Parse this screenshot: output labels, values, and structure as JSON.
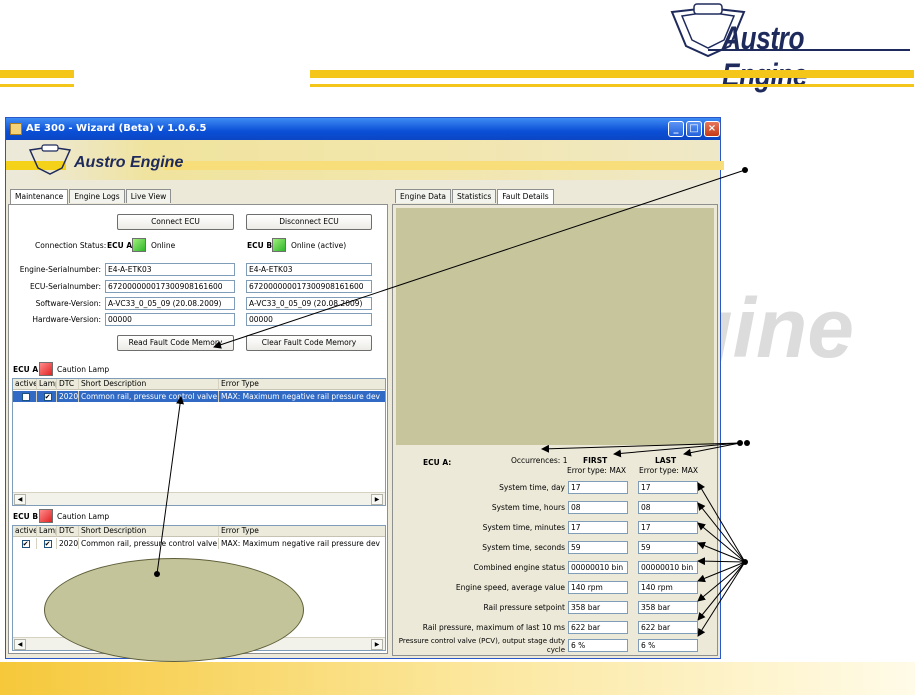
{
  "brand": {
    "name": "Austro Engine",
    "watermark": "ngine"
  },
  "window": {
    "title": "AE 300 - Wizard (Beta) v 1.0.6.5",
    "logo_text": "Austro Engine",
    "controls": {
      "minimize": "_",
      "maximize": "□",
      "close": "×"
    }
  },
  "left_tabs": [
    "Maintenance",
    "Engine Logs",
    "Live View"
  ],
  "connection": {
    "connect_label": "Connect ECU",
    "disconnect_label": "Disconnect ECU",
    "status_label": "Connection Status:",
    "ecu_a_label": "ECU A",
    "ecu_a_status": "Online",
    "ecu_b_label": "ECU B",
    "ecu_b_status": "Online (active)",
    "rows": [
      {
        "label": "Engine-Serialnumber:",
        "a": "E4-A-ETK03",
        "b": "E4-A-ETK03"
      },
      {
        "label": "ECU-Serialnumber:",
        "a": "67200000001730090816​1600",
        "b": "672000000017300908161600"
      },
      {
        "label": "Software-Version:",
        "a": "A-VC33_0_05_09 (20.08.2009)",
        "b": "A-VC33_0_05_09 (20.08.2009)"
      },
      {
        "label": "Hardware-Version:",
        "a": "00000",
        "b": "00000"
      }
    ],
    "read_label": "Read Fault Code Memory",
    "clear_label": "Clear Fault Code Memory"
  },
  "ecu_a_list": {
    "header_label": "ECU A",
    "lamp_label": "Caution Lamp",
    "columns": [
      "active",
      "Lamp",
      "DTC",
      "Short Description",
      "Error Type"
    ],
    "rows": [
      {
        "active": "",
        "lamp": "✔",
        "dtc": "2020",
        "desc": "Common rail, pressure control valve f...",
        "type": "MAX: Maximum negative rail pressure dev"
      }
    ]
  },
  "ecu_b_list": {
    "header_label": "ECU B",
    "lamp_label": "Caution Lamp",
    "columns": [
      "active",
      "Lamp",
      "DTC",
      "Short Description",
      "Error Type"
    ],
    "rows": [
      {
        "active": "✔",
        "lamp": "✔",
        "dtc": "2020",
        "desc": "Common rail, pressure control valve f...",
        "type": "MAX: Maximum negative rail pressure dev"
      }
    ]
  },
  "scroll": {
    "left": "◀",
    "right": "▶"
  },
  "right_tabs": [
    "Engine Data",
    "Statistics",
    "Fault Details"
  ],
  "fault_details": {
    "ecu_label": "ECU A:",
    "occurrences_label": "Occurrences: 1",
    "first_label": "FIRST",
    "last_label": "LAST",
    "first_type": "Error type: MAX",
    "last_type": "Error type: MAX",
    "rows": [
      {
        "label": "System time, day",
        "first": "17",
        "last": "17"
      },
      {
        "label": "System time, hours",
        "first": "08",
        "last": "08"
      },
      {
        "label": "System time, minutes",
        "first": "17",
        "last": "17"
      },
      {
        "label": "System time, seconds",
        "first": "59",
        "last": "59"
      },
      {
        "label": "Combined engine status",
        "first": "00000010 bin",
        "last": "00000010 bin"
      },
      {
        "label": "Engine speed, average value",
        "first": "140 rpm",
        "last": "140 rpm"
      },
      {
        "label": "Rail pressure setpoint",
        "first": "358 bar",
        "last": "358 bar"
      },
      {
        "label": "Rail pressure, maximum of last 10 ms",
        "first": "622 bar",
        "last": "622 bar"
      },
      {
        "label": "Pressure control valve (PCV), output stage duty cycle",
        "first": "6 %",
        "last": "6 %"
      }
    ]
  },
  "colors": {
    "accent": "#f4c61a",
    "brand_navy": "#1e2a5c",
    "olive": "#c6c59c",
    "selection": "#316ac5"
  }
}
